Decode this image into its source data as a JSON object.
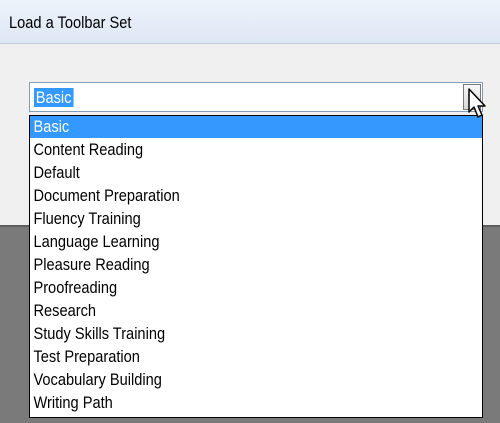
{
  "dialog": {
    "title": "Load a Toolbar Set"
  },
  "combo": {
    "value": "Basic"
  },
  "dropdown": {
    "selected_index": 0,
    "items": [
      "Basic",
      "Content Reading",
      "Default",
      "Document Preparation",
      "Fluency Training",
      "Language Learning",
      "Pleasure Reading",
      "Proofreading",
      "Research",
      "Study Skills Training",
      "Test Preparation",
      "Vocabulary Building",
      "Writing Path"
    ]
  },
  "icons": {
    "dropdown_arrow": "chevron-down-icon",
    "pointer": "mouse-pointer-icon"
  },
  "colors": {
    "selection": "#3399ff",
    "title_bar": "#dde7f4",
    "lower_panel": "#7a7a7a"
  }
}
